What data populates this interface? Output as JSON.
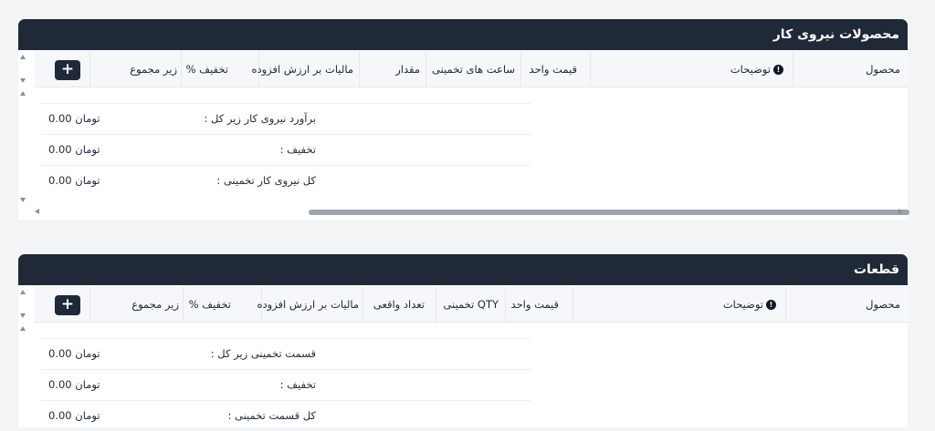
{
  "labour_panel": {
    "title": "محصولات نیروی کار",
    "add_label": "+",
    "info_glyph": "!",
    "columns": {
      "product": "محصول",
      "description": "توضیحات",
      "unit_price": "قیمت واحد",
      "estimated_hours": "ساعت های تخمینی",
      "quantity": "مقدار",
      "vat": "مالیات بر ارزش افزوده",
      "discount": "تخفیف %",
      "subtotal": "زیر مجموع"
    },
    "summary": [
      {
        "label": "برآورد نیروی کار زیر کل :",
        "value": "0.00 تومان"
      },
      {
        "label": "تخفیف :",
        "value": "0.00 تومان"
      },
      {
        "label": "کل نیروی کار تخمینی :",
        "value": "0.00 تومان"
      }
    ]
  },
  "parts_panel": {
    "title": "قطعات",
    "add_label": "+",
    "info_glyph": "!",
    "columns": {
      "product": "محصول",
      "description": "توضیحات",
      "unit_price": "قیمت واحد",
      "estimated_qty": "QTY تخمینی",
      "actual_count": "تعداد واقعی",
      "vat": "مالیات بر ارزش افزوده",
      "discount": "تخفیف %",
      "subtotal": "زیر مجموع"
    },
    "summary": [
      {
        "label": "قسمت تخمینی زیر کل :",
        "value": "0.00 تومان"
      },
      {
        "label": "تخفیف :",
        "value": "0.00 تومان"
      },
      {
        "label": "کل قسمت تخمینی :",
        "value": "0.00 تومان"
      }
    ]
  },
  "icons": {
    "info": "info-circle-icon",
    "add": "plus-icon",
    "scroll_up": "triangle-up-icon",
    "scroll_down": "triangle-down-icon",
    "scroll_left": "triangle-left-icon",
    "scroll_right": "triangle-right-icon"
  },
  "colors": {
    "header_bg": "#1f2937",
    "table_head_bg": "#f5f7fa",
    "page_bg": "#f3f4f6",
    "scrollbar": "#9ca3af"
  }
}
